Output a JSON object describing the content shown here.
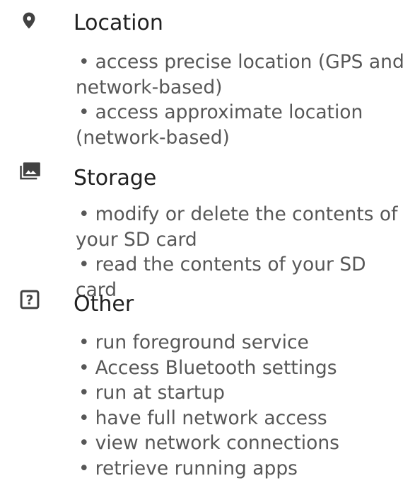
{
  "groups": [
    {
      "icon": "location-pin-icon",
      "title": "Location",
      "items": [
        "access precise location (GPS and network-based)",
        "access approximate location (network-based)"
      ]
    },
    {
      "icon": "photo-library-icon",
      "title": "Storage",
      "items": [
        "modify or delete the contents of your SD card",
        "read the contents of your SD card"
      ]
    },
    {
      "icon": "question-box-icon",
      "title": "Other",
      "items": [
        "run foreground service",
        "Access Bluetooth settings",
        "run at startup",
        "have full network access",
        "view network connections",
        "retrieve running apps"
      ]
    }
  ],
  "bullet_char": "•",
  "colors": {
    "icon": "#424242",
    "title": "#202020",
    "item_text": "#575757",
    "background": "#ffffff"
  }
}
